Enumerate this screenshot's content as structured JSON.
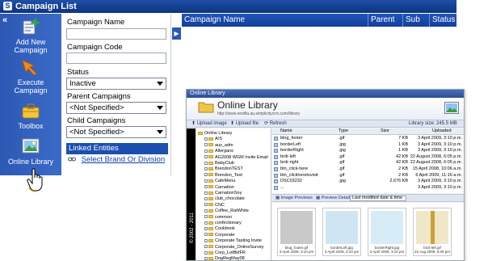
{
  "campaign_list": {
    "title": "Campaign List",
    "collapse_glyph": "«",
    "sidebar": [
      {
        "label": "Add New Campaign",
        "icon": "add-campaign-icon"
      },
      {
        "label": "Execute Campaign",
        "icon": "execute-arrow-icon"
      },
      {
        "label": "Toolbox",
        "icon": "toolbox-icon"
      },
      {
        "label": "Online Library",
        "icon": "online-library-icon"
      }
    ],
    "form": {
      "campaign_name_label": "Campaign Name",
      "campaign_code_label": "Campaign Code",
      "status_label": "Status",
      "status_value": "Inactive",
      "parent_campaigns_label": "Parent Campaigns",
      "parent_campaigns_value": "<Not Specified>",
      "child_campaigns_label": "Child Campaigns",
      "child_campaigns_value": "<Not Specified>",
      "linked_entities_label": "Linked Entities",
      "select_brand_link": "Select Brand Or Division"
    },
    "expander_glyph": "▶",
    "grid_columns": [
      "Campaign Name",
      "Parent",
      "Sub",
      "Status"
    ]
  },
  "online_library": {
    "window_title": "Online Library",
    "heading": "Online Library",
    "url": "http://www.nestfia.au.simplicitycrm.com/library",
    "toolbar": {
      "upload_image": "Upload image",
      "upload_file": "Upload file",
      "refresh": "Refresh",
      "library_size": "Library size: 245.5 MB"
    },
    "year_strip": "© 2002 - 2011",
    "tree": [
      "Online Library",
      "A/S",
      "aus_adm",
      "Allergans",
      "AG2008 WGM Invite Email",
      "BabyClub",
      "BrendonTEST",
      "Brendon_Test",
      "CafeMenu",
      "Carnation",
      "CarnationSoy",
      "club_chocolate",
      "CNC",
      "Coffee_RatWhite",
      "common",
      "confectionary",
      "Cookbook",
      "Corporate",
      "Corporate Tasting Invite",
      "Corporate_OnlineSurvey",
      "Corp_LotBkfFR",
      "DogRegMay08"
    ],
    "file_columns": [
      "Name",
      "Type",
      "Size",
      "Uploaded"
    ],
    "files": [
      {
        "name": "blog_footer",
        "type": ".gif",
        "size": "7 KB",
        "uploaded": "3 April 2009, 3:10 p.m."
      },
      {
        "name": "borderLeft",
        "type": ".jpg",
        "size": "1 KB",
        "uploaded": "3 April 2009, 3:10 p.m."
      },
      {
        "name": "borderRight",
        "type": ".jpg",
        "size": "1 KB",
        "uploaded": "3 April 2009, 3:10 p.m."
      },
      {
        "name": "brdr-left",
        "type": ".gif",
        "size": "42 KB",
        "uploaded": "22 August 2008, 6:05 p.m."
      },
      {
        "name": "brdr-right",
        "type": ".gif",
        "size": "42 KB",
        "uploaded": "22 August 2008, 6:05 p.m."
      },
      {
        "name": "btn_click-here",
        "type": ".gif",
        "size": "2 KB",
        "uploaded": "15 April 2008, 10:06 a.m."
      },
      {
        "name": "btn_clickheretovisit",
        "type": ".gif",
        "size": "2 KB",
        "uploaded": "6 April 2009, 11:16 a.m."
      },
      {
        "name": "DSC03232",
        "type": ".jpg",
        "size": "2,676 KB",
        "uploaded": "3 April 2009, 3:10 p.m."
      },
      {
        "name": "...",
        "type": "",
        "size": "",
        "uploaded": "3 April 2009, 3:10 p.m."
      }
    ],
    "previews_bar": {
      "image_previews": "Image Previews",
      "preview_details": "Preview Details",
      "sort": "Last modified date & time"
    },
    "thumbnails": [
      {
        "caption": "blog_footer.gif",
        "date": "3 April 2009, 3:10 pm"
      },
      {
        "caption": "borderLeft.jpg",
        "date": "3 April 2009, 3:10 pm"
      },
      {
        "caption": "borderRight.jpg",
        "date": "3 April 2009, 3:10 pm"
      },
      {
        "caption": "brdr-left.gif",
        "date": "22 Aug 2008, 6:05 pm"
      }
    ]
  },
  "colors": {
    "sidebar_blue": "#3363c0",
    "header_blue": "#13409a",
    "linked_blue": "#1d4fb0"
  }
}
